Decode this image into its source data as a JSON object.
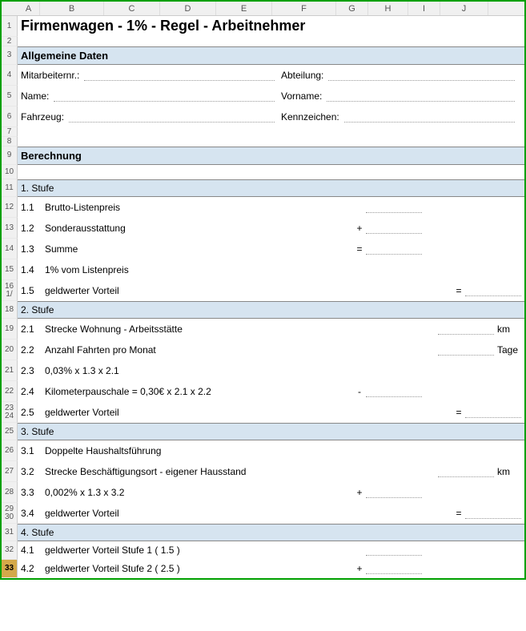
{
  "cols": [
    "A",
    "B",
    "C",
    "D",
    "E",
    "F",
    "G",
    "H",
    "I",
    "J"
  ],
  "title": "Firmenwagen - 1% - Regel - Arbeitnehmer",
  "section1": "Allgemeine Daten",
  "fields": {
    "mitarbeiternr": "Mitarbeiternr.:",
    "abteilung": "Abteilung:",
    "name": "Name:",
    "vorname": "Vorname:",
    "fahrzeug": "Fahrzeug:",
    "kennzeichen": "Kennzeichen:"
  },
  "section2": "Berechnung",
  "stufe1": {
    "head": "1. Stufe",
    "r1_n": "1.1",
    "r1_t": "Brutto-Listenpreis",
    "r2_n": "1.2",
    "r2_t": "Sonderausstattung",
    "r2_op": "+",
    "r3_n": "1.3",
    "r3_t": "Summe",
    "r3_op": "=",
    "r4_n": "1.4",
    "r4_t": "1% vom Listenpreis",
    "r5_n": "1.5",
    "r5_t": "geldwerter Vorteil",
    "r5_op": "="
  },
  "stufe2": {
    "head": "2. Stufe",
    "r1_n": "2.1",
    "r1_t": "Strecke Wohnung - Arbeitsstätte",
    "r1_u": "km",
    "r2_n": "2.2",
    "r2_t": "Anzahl Fahrten pro Monat",
    "r2_u": "Tage",
    "r3_n": "2.3",
    "r3_t": "0,03% x 1.3 x 2.1",
    "r4_n": "2.4",
    "r4_t": "Kilometerpauschale = 0,30€ x 2.1 x 2.2",
    "r4_op": "-",
    "r5_n": "2.5",
    "r5_t": "geldwerter Vorteil",
    "r5_op": "="
  },
  "stufe3": {
    "head": "3. Stufe",
    "r1_n": "3.1",
    "r1_t": "Doppelte Haushaltsführung",
    "r2_n": "3.2",
    "r2_t": "Strecke Beschäftigungsort - eigener Hausstand",
    "r2_u": "km",
    "r3_n": "3.3",
    "r3_t": "0,002% x 1.3 x 3.2",
    "r3_op": "+",
    "r4_n": "3.4",
    "r4_t": "geldwerter Vorteil",
    "r4_op": "="
  },
  "stufe4": {
    "head": "4. Stufe",
    "r1_n": "4.1",
    "r1_t": "geldwerter Vorteil Stufe 1 ( 1.5 )",
    "r2_n": "4.2",
    "r2_t": "geldwerter Vorteil Stufe 2 ( 2.5 )",
    "r2_op": "+"
  }
}
